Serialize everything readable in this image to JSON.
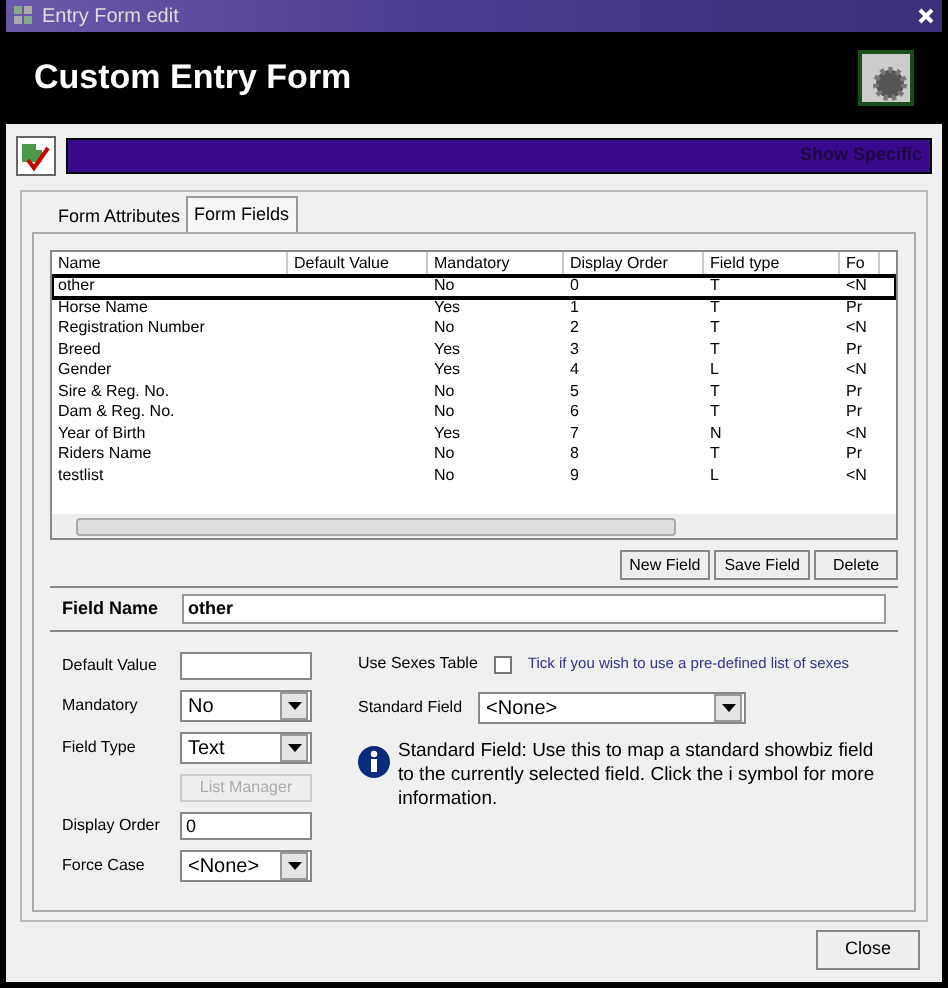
{
  "window": {
    "title": "Entry Form edit"
  },
  "header": {
    "title": "Custom Entry Form"
  },
  "toolbar": {
    "banner_text": "Show Specific"
  },
  "tabs": [
    {
      "label": "Form Attributes",
      "selected": false
    },
    {
      "label": "Form Fields",
      "selected": true
    }
  ],
  "table": {
    "columns": [
      "Name",
      "Default Value",
      "Mandatory",
      "Display Order",
      "Field type",
      "Fo"
    ],
    "rows": [
      {
        "cells": [
          "other",
          "",
          "No",
          "0",
          "T",
          "<N"
        ],
        "selected": true
      },
      {
        "cells": [
          "Horse Name",
          "",
          "Yes",
          "1",
          "T",
          "Pr"
        ],
        "selected": false
      },
      {
        "cells": [
          "Registration Number",
          "",
          "No",
          "2",
          "T",
          "<N"
        ],
        "selected": false
      },
      {
        "cells": [
          "Breed",
          "",
          "Yes",
          "3",
          "T",
          "Pr"
        ],
        "selected": false
      },
      {
        "cells": [
          "Gender",
          "",
          "Yes",
          "4",
          "L",
          "<N"
        ],
        "selected": false
      },
      {
        "cells": [
          "Sire & Reg. No.",
          "",
          "No",
          "5",
          "T",
          "Pr"
        ],
        "selected": false
      },
      {
        "cells": [
          "Dam & Reg. No.",
          "",
          "No",
          "6",
          "T",
          "Pr"
        ],
        "selected": false
      },
      {
        "cells": [
          "Year of Birth",
          "",
          "Yes",
          "7",
          "N",
          "<N"
        ],
        "selected": false
      },
      {
        "cells": [
          "Riders Name",
          "",
          "No",
          "8",
          "T",
          "Pr"
        ],
        "selected": false
      },
      {
        "cells": [
          "testlist",
          "",
          "No",
          "9",
          "L",
          "<N"
        ],
        "selected": false
      }
    ]
  },
  "list_buttons": [
    "New Field",
    "Save Field",
    "Delete"
  ],
  "field_name": {
    "label": "Field Name",
    "value": "other"
  },
  "form": {
    "default_value": {
      "label": "Default Value"
    },
    "mandatory": {
      "label": "Mandatory",
      "value": "No"
    },
    "field_type": {
      "label": "Field Type",
      "value": "Text"
    },
    "list_manager": {
      "label": "List Manager",
      "disabled": true
    },
    "display_order": {
      "label": "Display Order",
      "value": "0"
    },
    "force_case": {
      "label": "Force Case",
      "value": "<None>"
    },
    "use_sexes_table": {
      "label": "Use Sexes Table",
      "checked": false,
      "hint": "Tick if you wish to use a pre-defined list of sexes"
    },
    "standard_field": {
      "label": "Standard Field",
      "value": "<None>"
    },
    "info": "Standard Field: Use this to map a standard showbiz field to the currently selected field. Click the i symbol for more information."
  },
  "close_button": "Close"
}
